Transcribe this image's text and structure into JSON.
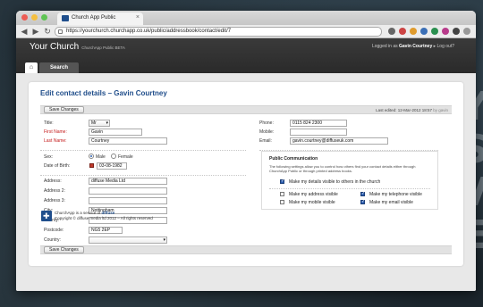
{
  "background": {
    "text_lines": [
      "LY",
      "S",
      "OV",
      "RE"
    ]
  },
  "browser": {
    "tab_title": "Church App Public",
    "url": "https://yourchurch.churchapp.co.uk/public/addressbook/contact/edit/7"
  },
  "header": {
    "brand": "Your Church",
    "brand_sub": "ChurchApp Public BETA",
    "logged_in_prefix": "Logged in as",
    "user_name": "Gavin Courtney",
    "logout_label": "Log out?",
    "nav": {
      "home_icon": "home-icon",
      "search_label": "Search"
    }
  },
  "page": {
    "title": "Edit contact details – Gavin Courtney",
    "save_label": "Save Changes",
    "last_edited_label": "Last edited: 12-Mar-2012 18:57",
    "last_edited_by": "by gavin"
  },
  "form": {
    "title_label": "Title:",
    "title_value": "Mr",
    "first_name_label": "First Name:",
    "first_name_value": "Gavin",
    "last_name_label": "Last Name:",
    "last_name_value": "Courtney",
    "phone_label": "Phone:",
    "phone_value": "0115 824 2300",
    "mobile_label": "Mobile:",
    "mobile_value": "",
    "email_label": "Email:",
    "email_value": "gavin.courtney@diffuseuk.com",
    "sex_label": "Sex:",
    "sex_male": "Male",
    "sex_female": "Female",
    "sex_selected": "Male",
    "dob_label": "Date of Birth:",
    "dob_value": "03-08-1982",
    "address_label": "Address:",
    "address_value": "diffuse Media Ltd",
    "address2_label": "Address 2:",
    "address2_value": "",
    "address3_label": "Address 3:",
    "address3_value": "",
    "city_label": "City:",
    "city_value": "Nottingham",
    "county_label": "County:",
    "county_value": "",
    "postcode_label": "Postcode:",
    "postcode_value": "NG5 2EP",
    "country_label": "Country:",
    "country_value": ""
  },
  "public_communication": {
    "title": "Public Communication",
    "description": "The following settings allow you to control how others find your contact details either through ChurchApp Public or through printed address books.",
    "visible_label": "Make my details visible to others in the church",
    "visible_checked": true,
    "address_label": "Make my address visible",
    "address_checked": false,
    "telephone_label": "Make my telephone visible",
    "telephone_checked": true,
    "mobile_label": "Make my mobile visible",
    "mobile_checked": false,
    "email_label": "Make my email visible",
    "email_checked": true
  },
  "footer": {
    "service_prefix": "ChurchApp is a service of",
    "service_company": "diffuse",
    "copyright": "Copyright © diffuse media ltd 2012 – All rights reserved"
  },
  "colors": {
    "accent": "#1f4d8a",
    "required": "#c41a1a",
    "header_bg": "#2f2f2f"
  }
}
